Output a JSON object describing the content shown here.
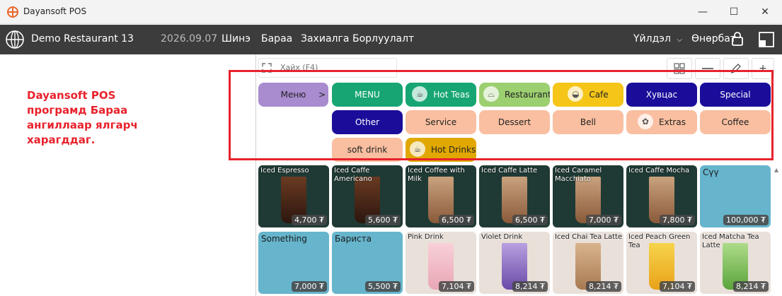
{
  "window": {
    "title": "Dayansoft POS",
    "minimize": "—",
    "maximize": "☐",
    "close": "✕"
  },
  "navbar": {
    "restaurant": "Demo Restaurant 13",
    "date": "2026.09.07",
    "menu_new": "Шинэ",
    "menu_items": "Бараа",
    "menu_orders": "Захиалга",
    "menu_sales": "Борлуулалт",
    "operations": "Үйлдэл",
    "user": "Өнөрбат"
  },
  "note": "Dayansoft POS програмд Бараа ангиллаар ялгарч харагддаг.",
  "search": {
    "placeholder": "Хайх (F4)"
  },
  "categories": [
    {
      "label": "Меню",
      "color": "#a98ccf",
      "arrow": ">"
    },
    {
      "label": "MENU",
      "color": "#17a673"
    },
    {
      "label": "Hot Teas",
      "color": "#17a673",
      "icon": "cup-icon"
    },
    {
      "label": "Restaurant",
      "color": "#9ccf70",
      "icon": "cloche-icon"
    },
    {
      "label": "Cafe",
      "color": "#f5c518",
      "icon": "coffee-bean-icon"
    },
    {
      "label": "Хувцас",
      "color": "#1a0d9a"
    },
    {
      "label": "Special",
      "color": "#1a0d9a"
    },
    {
      "label": "Other",
      "color": "#1a0d9a"
    },
    {
      "label": "Service",
      "color": "#f9bfa0"
    },
    {
      "label": "Dessert",
      "color": "#f9bfa0"
    },
    {
      "label": "Bell",
      "color": "#f9bfa0"
    },
    {
      "label": "Extras",
      "color": "#f9bfa0",
      "icon": "extras-icon"
    },
    {
      "label": "Coffee",
      "color": "#f9bfa0"
    },
    {
      "label": "soft drink",
      "color": "#f9bfa0"
    },
    {
      "label": "Hot Drinks",
      "color": "#e0a800",
      "icon": "cup-icon"
    }
  ],
  "products": [
    {
      "name": "Iced Espresso",
      "price": "4,700 ₮"
    },
    {
      "name": "Iced Caffe Americano",
      "price": "5,600 ₮"
    },
    {
      "name": "Iced Coffee with Milk",
      "price": "6,500 ₮"
    },
    {
      "name": "Iced Caffe Latte",
      "price": "6,500 ₮"
    },
    {
      "name": "Iced Caramel Macchiato",
      "price": "7,000 ₮"
    },
    {
      "name": "Iced Caffe Mocha",
      "price": "7,800 ₮"
    },
    {
      "name": "Сүү",
      "price": "100,000 ₮"
    },
    {
      "name": "Something",
      "price": "7,000 ₮"
    },
    {
      "name": "Бариста",
      "price": "5,500 ₮"
    },
    {
      "name": "Pink Drink",
      "price": "7,104 ₮"
    },
    {
      "name": "Violet Drink",
      "price": "8,214 ₮"
    },
    {
      "name": "Iced Chai Tea Latte",
      "price": "8,214 ₮"
    },
    {
      "name": "Iced Peach Green Tea",
      "price": "7,104 ₮"
    },
    {
      "name": "Iced Matcha Tea Latte",
      "price": "8,214 ₮"
    }
  ]
}
